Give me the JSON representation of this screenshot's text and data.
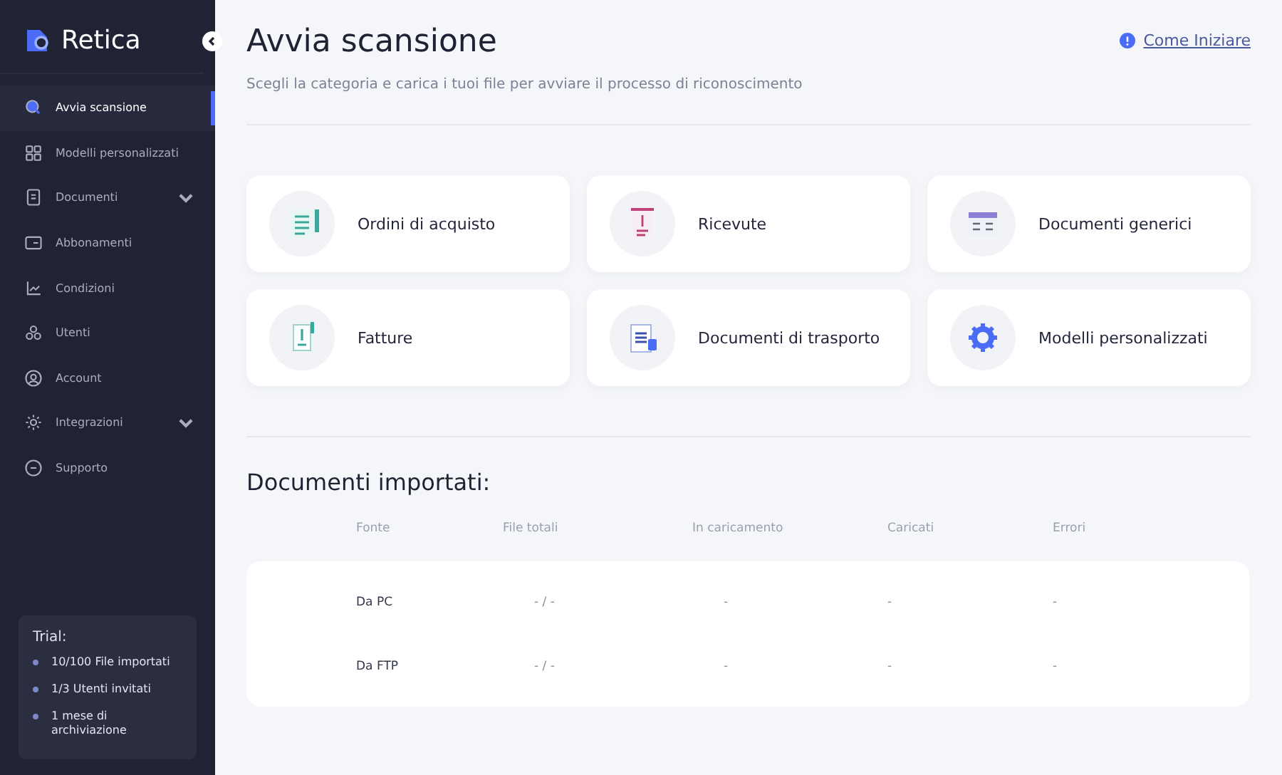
{
  "sidebar": {
    "brand": "Retica",
    "items": [
      {
        "label": "Avvia scansione",
        "selected": true,
        "has_submenu": false
      },
      {
        "label": "Modelli personalizzati",
        "selected": false,
        "has_submenu": false
      },
      {
        "label": "Documenti",
        "selected": false,
        "has_submenu": true
      },
      {
        "label": "Abbonamenti",
        "selected": false,
        "has_submenu": false
      },
      {
        "label": "Condizioni",
        "selected": false,
        "has_submenu": false
      },
      {
        "label": "Utenti",
        "selected": false,
        "has_submenu": false
      },
      {
        "label": "Account",
        "selected": false,
        "has_submenu": false
      },
      {
        "label": "Integrazioni",
        "selected": false,
        "has_submenu": true
      },
      {
        "label": "Supporto",
        "selected": false,
        "has_submenu": false
      }
    ],
    "trial": {
      "title": "Trial:",
      "items": [
        "10/100 File importati",
        "1/3 Utenti invitati",
        "1 mese di archiviazione"
      ]
    }
  },
  "header": {
    "title": "Avvia scansione",
    "subtitle": "Scegli la categoria e carica i tuoi file per avviare il processo di riconoscimento",
    "help_link": "Come Iniziare"
  },
  "categories": [
    {
      "label": "Ordini di acquisto"
    },
    {
      "label": "Ricevute"
    },
    {
      "label": "Documenti generici"
    },
    {
      "label": "Fatture"
    },
    {
      "label": "Documenti di trasporto"
    },
    {
      "label": "Modelli personalizzati"
    }
  ],
  "imported": {
    "title": "Documenti importati:",
    "columns": [
      "Fonte",
      "File totali",
      "In caricamento",
      "Caricati",
      "Errori"
    ],
    "rows": [
      [
        "Da PC",
        "- / -",
        "-",
        "-",
        "-"
      ],
      [
        "Da FTP",
        "- / -",
        "-",
        "-",
        "-"
      ]
    ]
  }
}
